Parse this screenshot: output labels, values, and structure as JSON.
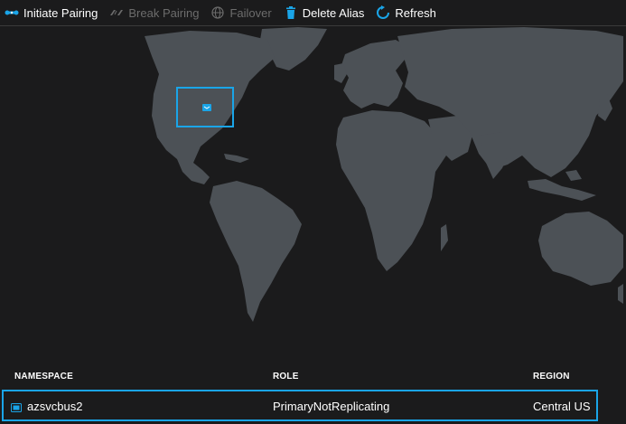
{
  "toolbar": {
    "initiate_pairing": "Initiate Pairing",
    "break_pairing": "Break Pairing",
    "failover": "Failover",
    "delete_alias": "Delete Alias",
    "refresh": "Refresh"
  },
  "map": {
    "marker_icon": "service-bus-namespace-icon"
  },
  "table": {
    "headers": {
      "namespace": "NAMESPACE",
      "role": "ROLE",
      "region": "REGION"
    },
    "rows": [
      {
        "namespace": "azsvcbus2",
        "role": "PrimaryNotReplicating",
        "region": "Central US"
      }
    ]
  },
  "colors": {
    "accent": "#1aa5e8",
    "land": "#4c5156",
    "background": "#1b1b1c"
  }
}
